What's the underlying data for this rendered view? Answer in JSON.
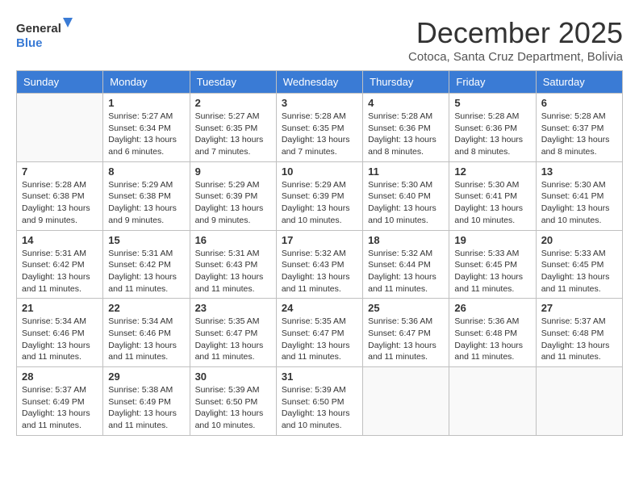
{
  "logo": {
    "general": "General",
    "blue": "Blue"
  },
  "title": "December 2025",
  "subtitle": "Cotoca, Santa Cruz Department, Bolivia",
  "days_of_week": [
    "Sunday",
    "Monday",
    "Tuesday",
    "Wednesday",
    "Thursday",
    "Friday",
    "Saturday"
  ],
  "weeks": [
    [
      {
        "day": "",
        "info": ""
      },
      {
        "day": "1",
        "info": "Sunrise: 5:27 AM\nSunset: 6:34 PM\nDaylight: 13 hours\nand 6 minutes."
      },
      {
        "day": "2",
        "info": "Sunrise: 5:27 AM\nSunset: 6:35 PM\nDaylight: 13 hours\nand 7 minutes."
      },
      {
        "day": "3",
        "info": "Sunrise: 5:28 AM\nSunset: 6:35 PM\nDaylight: 13 hours\nand 7 minutes."
      },
      {
        "day": "4",
        "info": "Sunrise: 5:28 AM\nSunset: 6:36 PM\nDaylight: 13 hours\nand 8 minutes."
      },
      {
        "day": "5",
        "info": "Sunrise: 5:28 AM\nSunset: 6:36 PM\nDaylight: 13 hours\nand 8 minutes."
      },
      {
        "day": "6",
        "info": "Sunrise: 5:28 AM\nSunset: 6:37 PM\nDaylight: 13 hours\nand 8 minutes."
      }
    ],
    [
      {
        "day": "7",
        "info": "Sunrise: 5:28 AM\nSunset: 6:38 PM\nDaylight: 13 hours\nand 9 minutes."
      },
      {
        "day": "8",
        "info": "Sunrise: 5:29 AM\nSunset: 6:38 PM\nDaylight: 13 hours\nand 9 minutes."
      },
      {
        "day": "9",
        "info": "Sunrise: 5:29 AM\nSunset: 6:39 PM\nDaylight: 13 hours\nand 9 minutes."
      },
      {
        "day": "10",
        "info": "Sunrise: 5:29 AM\nSunset: 6:39 PM\nDaylight: 13 hours\nand 10 minutes."
      },
      {
        "day": "11",
        "info": "Sunrise: 5:30 AM\nSunset: 6:40 PM\nDaylight: 13 hours\nand 10 minutes."
      },
      {
        "day": "12",
        "info": "Sunrise: 5:30 AM\nSunset: 6:41 PM\nDaylight: 13 hours\nand 10 minutes."
      },
      {
        "day": "13",
        "info": "Sunrise: 5:30 AM\nSunset: 6:41 PM\nDaylight: 13 hours\nand 10 minutes."
      }
    ],
    [
      {
        "day": "14",
        "info": "Sunrise: 5:31 AM\nSunset: 6:42 PM\nDaylight: 13 hours\nand 11 minutes."
      },
      {
        "day": "15",
        "info": "Sunrise: 5:31 AM\nSunset: 6:42 PM\nDaylight: 13 hours\nand 11 minutes."
      },
      {
        "day": "16",
        "info": "Sunrise: 5:31 AM\nSunset: 6:43 PM\nDaylight: 13 hours\nand 11 minutes."
      },
      {
        "day": "17",
        "info": "Sunrise: 5:32 AM\nSunset: 6:43 PM\nDaylight: 13 hours\nand 11 minutes."
      },
      {
        "day": "18",
        "info": "Sunrise: 5:32 AM\nSunset: 6:44 PM\nDaylight: 13 hours\nand 11 minutes."
      },
      {
        "day": "19",
        "info": "Sunrise: 5:33 AM\nSunset: 6:45 PM\nDaylight: 13 hours\nand 11 minutes."
      },
      {
        "day": "20",
        "info": "Sunrise: 5:33 AM\nSunset: 6:45 PM\nDaylight: 13 hours\nand 11 minutes."
      }
    ],
    [
      {
        "day": "21",
        "info": "Sunrise: 5:34 AM\nSunset: 6:46 PM\nDaylight: 13 hours\nand 11 minutes."
      },
      {
        "day": "22",
        "info": "Sunrise: 5:34 AM\nSunset: 6:46 PM\nDaylight: 13 hours\nand 11 minutes."
      },
      {
        "day": "23",
        "info": "Sunrise: 5:35 AM\nSunset: 6:47 PM\nDaylight: 13 hours\nand 11 minutes."
      },
      {
        "day": "24",
        "info": "Sunrise: 5:35 AM\nSunset: 6:47 PM\nDaylight: 13 hours\nand 11 minutes."
      },
      {
        "day": "25",
        "info": "Sunrise: 5:36 AM\nSunset: 6:47 PM\nDaylight: 13 hours\nand 11 minutes."
      },
      {
        "day": "26",
        "info": "Sunrise: 5:36 AM\nSunset: 6:48 PM\nDaylight: 13 hours\nand 11 minutes."
      },
      {
        "day": "27",
        "info": "Sunrise: 5:37 AM\nSunset: 6:48 PM\nDaylight: 13 hours\nand 11 minutes."
      }
    ],
    [
      {
        "day": "28",
        "info": "Sunrise: 5:37 AM\nSunset: 6:49 PM\nDaylight: 13 hours\nand 11 minutes."
      },
      {
        "day": "29",
        "info": "Sunrise: 5:38 AM\nSunset: 6:49 PM\nDaylight: 13 hours\nand 11 minutes."
      },
      {
        "day": "30",
        "info": "Sunrise: 5:39 AM\nSunset: 6:50 PM\nDaylight: 13 hours\nand 10 minutes."
      },
      {
        "day": "31",
        "info": "Sunrise: 5:39 AM\nSunset: 6:50 PM\nDaylight: 13 hours\nand 10 minutes."
      },
      {
        "day": "",
        "info": ""
      },
      {
        "day": "",
        "info": ""
      },
      {
        "day": "",
        "info": ""
      }
    ]
  ]
}
